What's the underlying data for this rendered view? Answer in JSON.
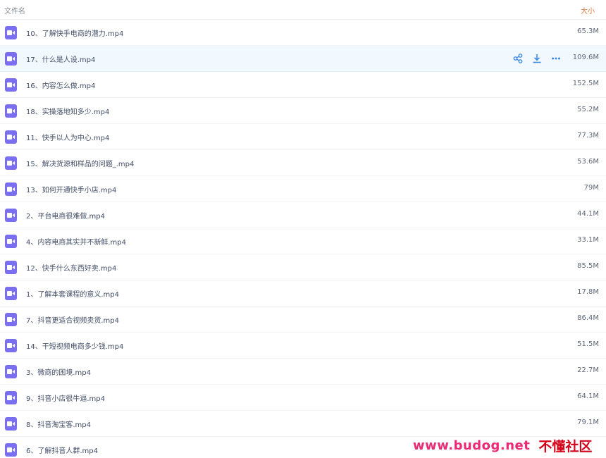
{
  "header": {
    "col_name": "文件名",
    "col_size": "大小"
  },
  "colors": {
    "video_icon": "#7a6ff0",
    "action_icon": "#3b8ae6",
    "hover_row": "#f2f9fe",
    "watermark_url": "#ea2a76",
    "watermark_name": "#d4001a"
  },
  "hovered_row_index": 1,
  "row_actions": [
    "share-icon",
    "download-icon",
    "more-icon"
  ],
  "files": [
    {
      "name": "10、了解快手电商的潜力.mp4",
      "size": "65.3M"
    },
    {
      "name": "17、什么是人设.mp4",
      "size": "109.6M"
    },
    {
      "name": "16、内容怎么做.mp4",
      "size": "152.5M"
    },
    {
      "name": "18、实操落地知多少.mp4",
      "size": "55.2M"
    },
    {
      "name": "11、快手以人为中心.mp4",
      "size": "77.3M"
    },
    {
      "name": "15、解决货源和样品的问题_.mp4",
      "size": "53.6M"
    },
    {
      "name": "13、如何开通快手小店.mp4",
      "size": "79M"
    },
    {
      "name": "2、平台电商很难做.mp4",
      "size": "44.1M"
    },
    {
      "name": "4、内容电商其实并不新鲜.mp4",
      "size": "33.1M"
    },
    {
      "name": "12、快手什么东西好卖.mp4",
      "size": "85.5M"
    },
    {
      "name": "1、了解本套课程的意义.mp4",
      "size": "17.8M"
    },
    {
      "name": "7、抖音更适合视频卖货.mp4",
      "size": "86.4M"
    },
    {
      "name": "14、干短视频电商多少钱.mp4",
      "size": "51.5M"
    },
    {
      "name": "3、微商的困境.mp4",
      "size": "22.7M"
    },
    {
      "name": "9、抖音小店很牛逼.mp4",
      "size": "64.1M"
    },
    {
      "name": "8、抖音淘宝客.mp4",
      "size": "79.1M"
    },
    {
      "name": "6、了解抖音人群.mp4",
      "size": ""
    }
  ],
  "watermark": {
    "url": "www.budog.net",
    "name": "不懂社区"
  }
}
